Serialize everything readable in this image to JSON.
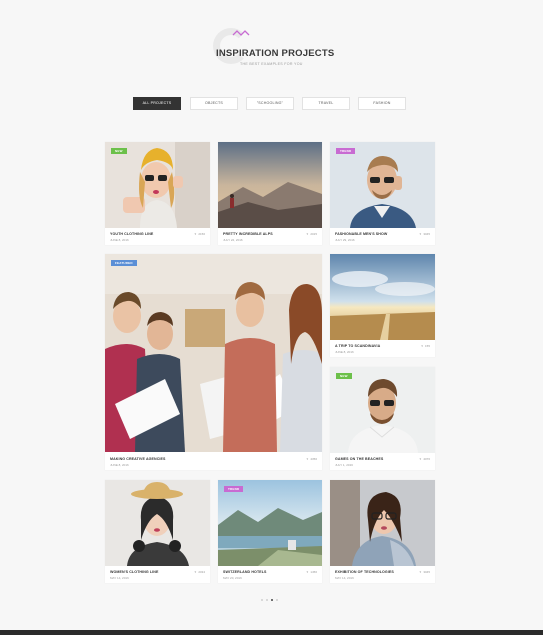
{
  "header": {
    "title": "INSPIRATION PROJECTS",
    "subtitle": "THE BEST EXAMPLES FOR YOU"
  },
  "filters": [
    "ALL PROJECTS",
    "OBJECTS",
    "\"SCHOOLING\"",
    "TRAVEL",
    "FASHION"
  ],
  "active_filter": "ALL PROJECTS",
  "colors": {
    "accent": "#c86bd2",
    "badge_new": "#6cc04a",
    "badge_trend": "#c86bd2",
    "badge_featured": "#5b8fd6",
    "dark": "#333333"
  },
  "cards": [
    {
      "title": "YOUTH CLOTHING LINE",
      "date": "JUNE 8, 2016",
      "likes": "2156",
      "badge": "NEW"
    },
    {
      "title": "PRETTY INCREDIBLE ALPS",
      "date": "JULY 22, 2016",
      "likes": "2015",
      "badge": ""
    },
    {
      "title": "FASHIONABLE MEN'S SHOW",
      "date": "JULY 29, 2016",
      "likes": "3045",
      "badge": "TREND"
    },
    {
      "title": "MAKING CREATIVE AGENCIES",
      "date": "JUNE 8, 2016",
      "likes": "4356",
      "badge": "FEATURED"
    },
    {
      "title": "A TRIP TO SCANDINAVIA",
      "date": "JUNE 8, 2016",
      "likes": "155",
      "badge": ""
    },
    {
      "title": "GAMES ON THE BEACHES",
      "date": "JULY 1, 2016",
      "likes": "4076",
      "badge": "NEW"
    },
    {
      "title": "WOMEN'S CLOTHING LINE",
      "date": "MAY 14, 2016",
      "likes": "2034",
      "badge": ""
    },
    {
      "title": "SWITZERLAND HOTELS",
      "date": "MAY 20, 2016",
      "likes": "1456",
      "badge": "TREND"
    },
    {
      "title": "EXHIBITION OF TECHNOLOGIES",
      "date": "MAY 14, 2016",
      "likes": "3045",
      "badge": ""
    }
  ],
  "pagination": {
    "pages": 4,
    "current": 3
  },
  "icons": {
    "likes": "heart-icon"
  }
}
